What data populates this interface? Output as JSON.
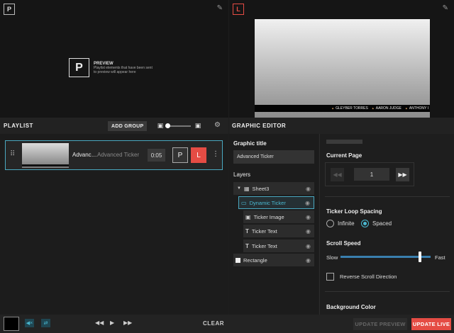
{
  "preview": {
    "badge": "P",
    "placeholder_big": "P",
    "placeholder_title": "PREVIEW",
    "placeholder_line1": "Playlist elements that have been sent",
    "placeholder_line2": "to preview will appear here"
  },
  "live": {
    "badge": "L",
    "ticker_names": [
      "GLEYBER TORRES",
      "AARON JUDGE",
      "ANTHONY I"
    ]
  },
  "playlist": {
    "title": "PLAYLIST",
    "add_group_label": "ADD GROUP",
    "item": {
      "name": "Advanc…",
      "type": "Advanced Ticker",
      "duration": "0:05",
      "preview_label": "P",
      "live_label": "L"
    }
  },
  "editor": {
    "title": "GRAPHIC EDITOR",
    "graphic_title_label": "Graphic title",
    "graphic_title_value": "Advanced Ticker",
    "layers_label": "Layers",
    "layers": [
      {
        "label": "Sheet3",
        "icon": "table-icon"
      },
      {
        "label": "Dynamic Ticker",
        "icon": "ticker-icon",
        "selected": true
      },
      {
        "label": "Ticker Image",
        "icon": "image-icon"
      },
      {
        "label": "Ticker Text",
        "icon": "text-icon"
      },
      {
        "label": "Ticker Text",
        "icon": "text-icon"
      },
      {
        "label": "Rectangle",
        "icon": "rect-icon"
      }
    ],
    "current_page_label": "Current Page",
    "current_page_value": "1",
    "loop_spacing_label": "Ticker Loop Spacing",
    "loop_options": [
      "Infinite",
      "Spaced"
    ],
    "loop_selected": "Spaced",
    "scroll_speed_label": "Scroll Speed",
    "speed_min_label": "Slow",
    "speed_max_label": "Fast",
    "speed_value": 0.88,
    "reverse_label": "Reverse Scroll Direction",
    "background_color_label": "Background Color"
  },
  "bottom": {
    "clear_label": "CLEAR",
    "update_preview_label": "UPDATE PREVIEW",
    "update_live_label": "UPDATE LIVE"
  },
  "colors": {
    "accent": "#4ab8d0",
    "live": "#e54c44"
  }
}
